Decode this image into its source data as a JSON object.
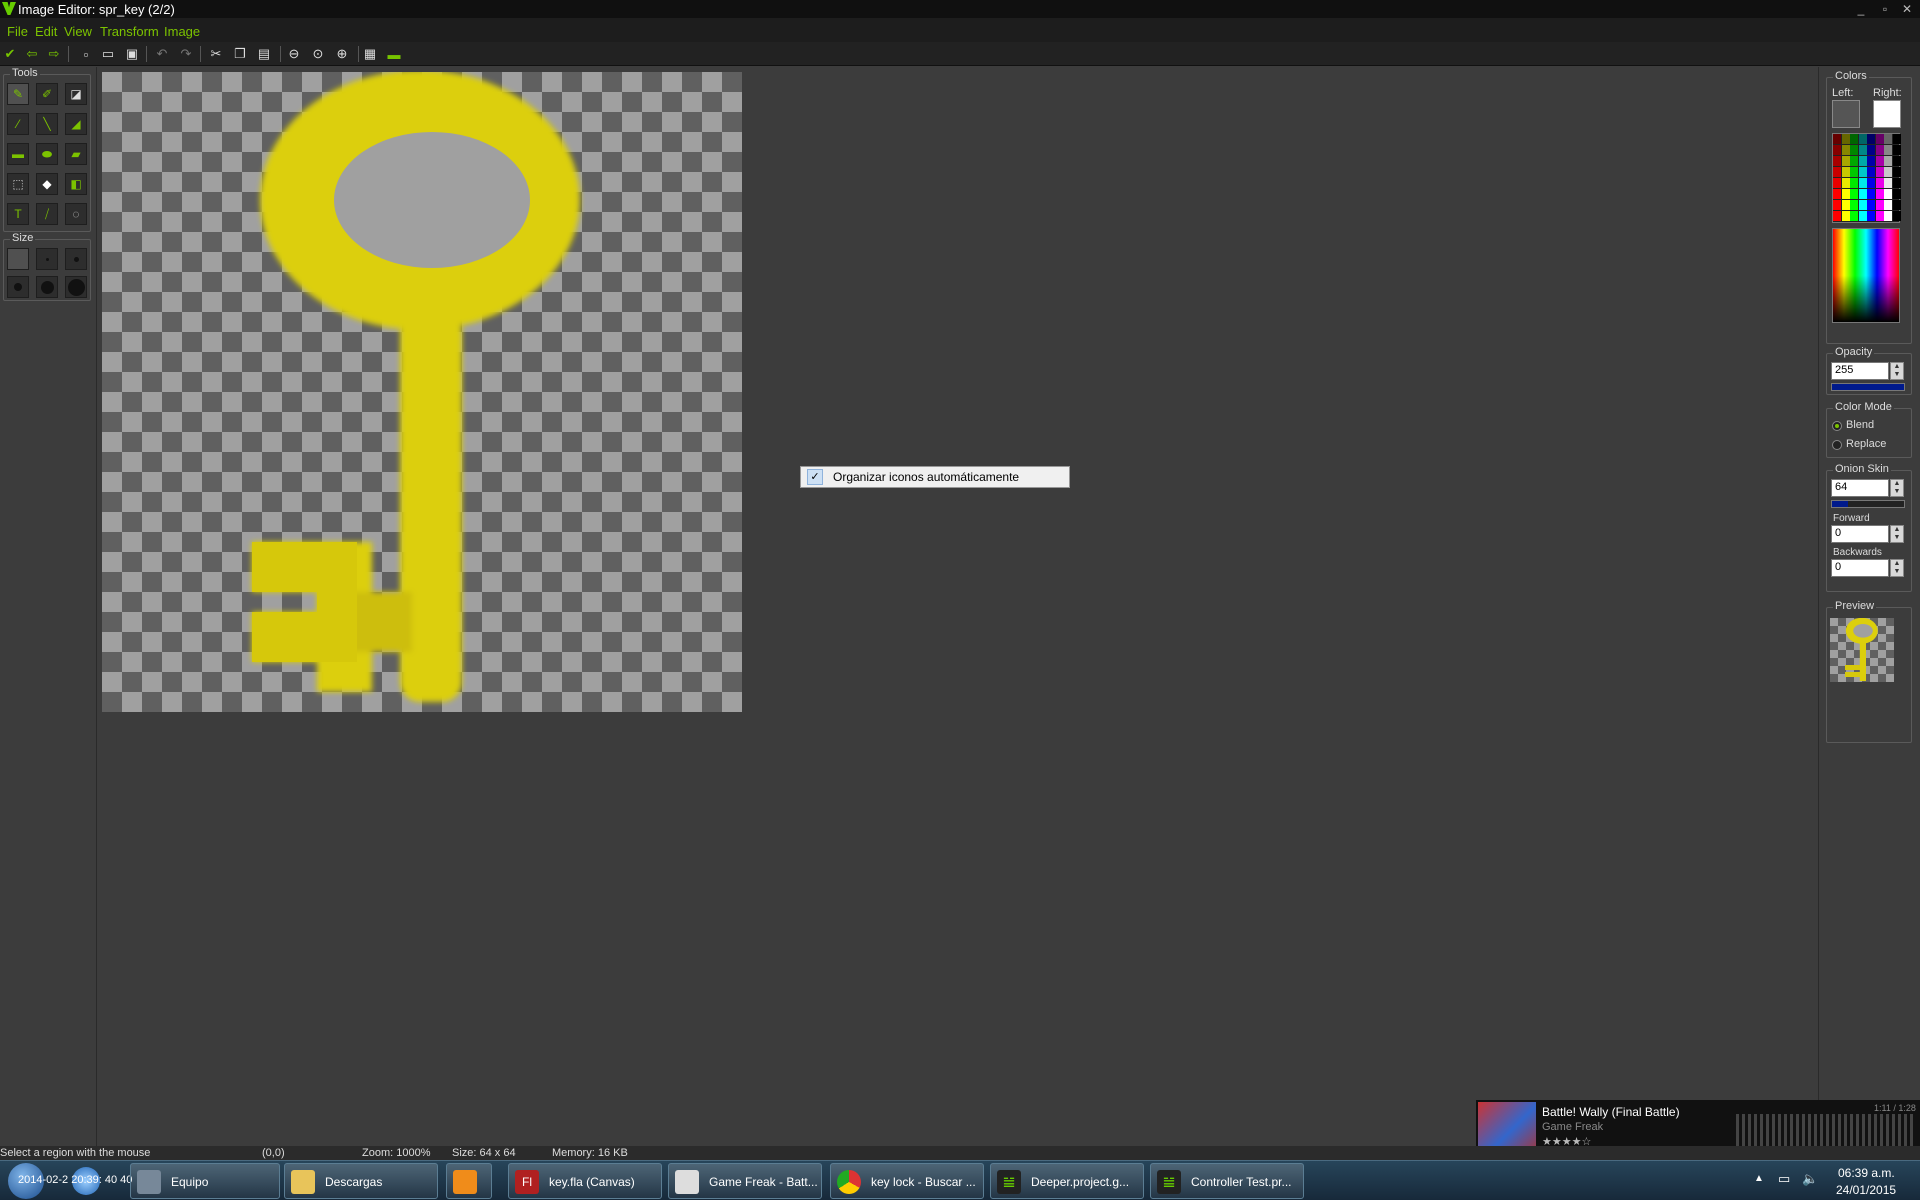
{
  "window": {
    "title": "Image Editor: spr_key (2/2)",
    "buttons": [
      "_",
      "▫",
      "✕"
    ]
  },
  "menu": [
    "File",
    "Edit",
    "View",
    "Transform",
    "Image"
  ],
  "left_panel": {
    "tools_label": "Tools",
    "size_label": "Size"
  },
  "context_menu": {
    "item": "Organizar iconos automáticamente",
    "checked": true
  },
  "right_panel": {
    "colors_label": "Colors",
    "left_label": "Left:",
    "right_label": "Right:",
    "left_color": "#555555",
    "right_color": "#ffffff",
    "opacity_label": "Opacity",
    "opacity_value": "255",
    "color_mode_label": "Color Mode",
    "blend_label": "Blend",
    "replace_label": "Replace",
    "color_mode_selected": "Blend",
    "onion_label": "Onion Skin",
    "onion_value": "64",
    "forward_label": "Forward",
    "forward_value": "0",
    "backwards_label": "Backwards",
    "backwards_value": "0",
    "preview_label": "Preview"
  },
  "status": {
    "hint": "Select a region with the mouse",
    "coords": "(0,0)",
    "zoom": "Zoom: 1000%",
    "size": "Size: 64 x 64",
    "memory": "Memory: 16 KB",
    "overlay": "2014-02-2 20:39: 40 40"
  },
  "taskbar": {
    "tasks": [
      "Equipo",
      "Descargas",
      "",
      "key.fla (Canvas)",
      "Game Freak - Batt...",
      "key lock - Buscar ...",
      "Deeper.project.g...",
      "Controller Test.pr..."
    ],
    "time": "06:39 a.m.",
    "date": "24/01/2015"
  },
  "now_playing": {
    "title": "Battle! Wally (Final Battle)",
    "artist": "Game Freak",
    "time": "1:11 / 1:28",
    "rating": 4
  }
}
